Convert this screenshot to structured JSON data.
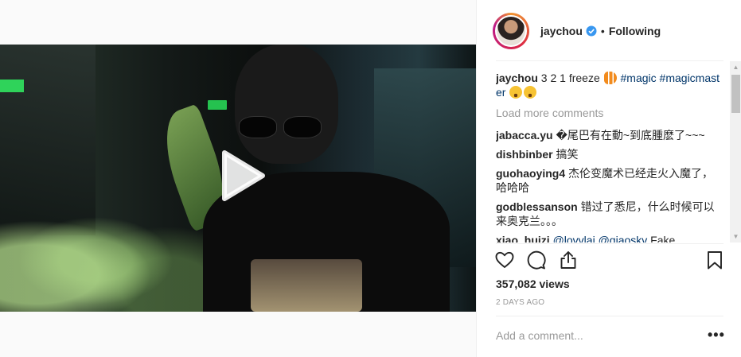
{
  "post": {
    "username": "jaychou",
    "follow_status": "Following",
    "separator": "•",
    "views": "357,082 views",
    "time": "2 DAYS AGO",
    "add_comment_placeholder": "Add a comment...",
    "more_options": "•••"
  },
  "caption": {
    "user": "jaychou",
    "text": " 3 2 1 freeze ",
    "emoji1": "tropical-fish-emoji",
    "tag1": "#magic",
    "tag2": "#magicmaster",
    "emoji2": "tired-face-emoji"
  },
  "load_more": "Load more comments",
  "comments": [
    {
      "user": "jabacca.yu",
      "text": "�尾巴有在動~到底腫麽了~~~"
    },
    {
      "user": "dishbinber",
      "text": "搞笑"
    },
    {
      "user": "guohaoying4",
      "text": "杰伦变魔术已经走火入魔了，哈哈哈"
    },
    {
      "user": "godblessanson",
      "text": "错过了悉尼，什么时候可以来奥克兰。。。"
    }
  ],
  "last_comment": {
    "user": "xiao_huizi",
    "mention1": "@lovvlai",
    "mention2": "@qiaoskv",
    "text": " Fake"
  },
  "colors": {
    "verified": "#3897f0",
    "link": "#003569",
    "muted": "#999999",
    "border": "#efefef"
  },
  "icons": [
    "heart-icon",
    "comment-icon",
    "share-icon",
    "bookmark-icon",
    "play-icon",
    "verified-badge-icon"
  ]
}
